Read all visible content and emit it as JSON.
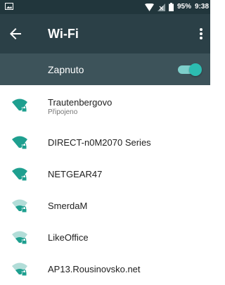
{
  "status_bar": {
    "battery": "95%",
    "time": "9:38",
    "icons": [
      "image-icon",
      "wifi-signal-icon",
      "cell-no-signal-icon",
      "battery-icon"
    ]
  },
  "app_bar": {
    "title": "Wi-Fi",
    "back_icon": "arrow-back-icon",
    "menu_icon": "more-vert-icon"
  },
  "toggle": {
    "label": "Zapnuto",
    "state": "on",
    "accent": "#2cbcb1"
  },
  "colors": {
    "status_bar": "#21363c",
    "app_bar": "#2b4047",
    "toggle_row": "#3d535a",
    "wifi_strong": "#1e9f8f",
    "wifi_weak": "#b2ddd8"
  },
  "networks": [
    {
      "name": "Trautenbergovo",
      "status": "Připojeno",
      "signal_bars": 4,
      "secured": true
    },
    {
      "name": "DIRECT-n0M2070 Series",
      "status": "",
      "signal_bars": 4,
      "secured": true
    },
    {
      "name": "NETGEAR47",
      "status": "",
      "signal_bars": 4,
      "secured": true
    },
    {
      "name": "SmerdaM",
      "status": "",
      "signal_bars": 2,
      "secured": true
    },
    {
      "name": "LikeOffice",
      "status": "",
      "signal_bars": 2,
      "secured": true
    },
    {
      "name": "AP13.Rousinovsko.net",
      "status": "",
      "signal_bars": 2,
      "secured": true
    }
  ]
}
